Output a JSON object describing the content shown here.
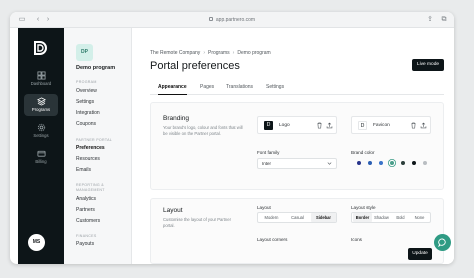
{
  "browser": {
    "url": "app.partnero.com"
  },
  "rail": {
    "items": [
      {
        "label": "Dashboard",
        "icon": "dashboard-icon"
      },
      {
        "label": "Programs",
        "icon": "programs-icon",
        "active": true
      },
      {
        "label": "Settings",
        "icon": "gear-icon"
      },
      {
        "label": "Billing",
        "icon": "billing-icon"
      }
    ],
    "avatar": "MS"
  },
  "sidebar": {
    "program_initials": "DP",
    "program_name": "Demo program",
    "sections": [
      {
        "title": "PROGRAM",
        "links": [
          "Overview",
          "Settings",
          "Integration",
          "Coupons"
        ]
      },
      {
        "title": "PARTNER PORTAL",
        "links": [
          "Preferences",
          "Resources",
          "Emails"
        ]
      },
      {
        "title": "REPORTING & MANAGEMENT",
        "links": [
          "Analytics",
          "Partners",
          "Customers"
        ]
      },
      {
        "title": "FINANCES",
        "links": [
          "Payouts"
        ]
      }
    ],
    "active_link": "Preferences"
  },
  "main": {
    "breadcrumbs": [
      "The Remote Company",
      "Programs",
      "Demo program"
    ],
    "title": "Portal preferences",
    "live_mode_label": "Live mode",
    "tabs": [
      "Appearance",
      "Pages",
      "Translations",
      "Settings"
    ],
    "active_tab": "Appearance",
    "branding": {
      "title": "Branding",
      "description": "Your brand's logo, colour and fonts that will be visible on the Partner portal.",
      "logo_label": "Logo",
      "favicon_label": "Favicon",
      "logo_initial": "D",
      "font_family_label": "Font family",
      "font_family_value": "Inter",
      "brand_color_label": "Brand color",
      "brand_colors": [
        "#27348b",
        "#2b5fb3",
        "#3a73c9",
        "#4a9e8a",
        "#2c3e3a",
        "#0d1518",
        "#b9bec2"
      ],
      "selected_color_index": 3
    },
    "layout": {
      "title": "Layout",
      "description": "Customise the layout of your Partner portal.",
      "layout_label": "Layout",
      "layout_options": [
        "Modern",
        "Casual",
        "Sidebar"
      ],
      "layout_selected": "Sidebar",
      "style_label": "Layout style",
      "style_options": [
        "Border",
        "Shadow",
        "Bold",
        "None"
      ],
      "style_selected": "Border",
      "corners_label": "Layout corners",
      "icons_label": "Icons"
    },
    "update_label": "Update"
  }
}
